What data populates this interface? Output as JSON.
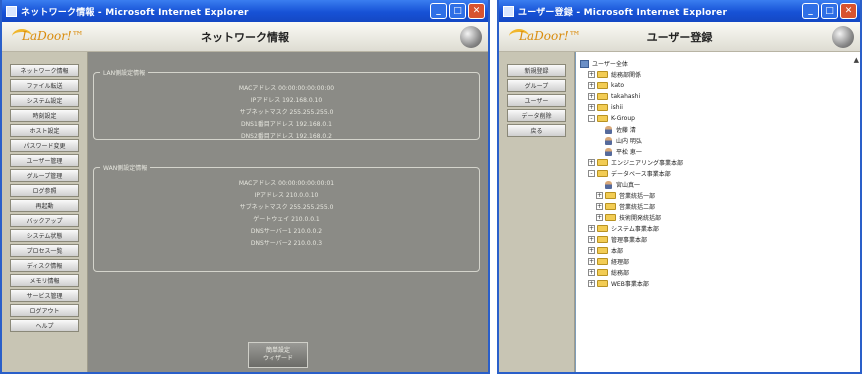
{
  "window1": {
    "title": "ネットワーク情報 - Microsoft Internet Explorer",
    "logo": "LaDoor!™",
    "app_title": "ネットワーク情報",
    "sidebar": [
      "ネットワーク情報",
      "ファイル転送",
      "システム設定",
      "時刻設定",
      "ホスト設定",
      "パスワード変更",
      "ユーザー管理",
      "グループ管理",
      "ログ参照",
      "再起動",
      "バックアップ",
      "システム状態",
      "プロセス一覧",
      "ディスク情報",
      "メモリ情報",
      "サービス管理",
      "ログアウト",
      "ヘルプ"
    ],
    "group1": {
      "legend": "LAN側設定情報",
      "rows": [
        "MACアドレス 00:00:00:00:00:00",
        "IPアドレス 192.168.0.10",
        "サブネットマスク 255.255.255.0",
        "DNS1番目アドレス 192.168.0.1",
        "DNS2番目アドレス 192.168.0.2"
      ]
    },
    "group2": {
      "legend": "WAN側設定情報",
      "rows": [
        "MACアドレス 00:00:00:00:00:01",
        "IPアドレス 210.0.0.10",
        "サブネットマスク 255.255.255.0",
        "ゲートウェイ 210.0.0.1",
        "DNSサーバー1 210.0.0.2",
        "DNSサーバー2 210.0.0.3"
      ]
    },
    "setup_button": [
      "簡単設定",
      "ウィザード"
    ]
  },
  "window2": {
    "title": "ユーザー登録 - Microsoft Internet Explorer",
    "logo": "LaDoor!™",
    "app_title": "ユーザー登録",
    "sidebar": [
      "新規登録",
      "グループ",
      "ユーザー",
      "データ削除",
      "戻る"
    ],
    "tree": [
      {
        "depth": 0,
        "type": "root",
        "exp": "",
        "label": "ユーザー全体"
      },
      {
        "depth": 1,
        "type": "folder",
        "exp": "+",
        "label": "総務部関係"
      },
      {
        "depth": 1,
        "type": "folder",
        "exp": "+",
        "label": "kato"
      },
      {
        "depth": 1,
        "type": "folder",
        "exp": "+",
        "label": "takahashi"
      },
      {
        "depth": 1,
        "type": "folder",
        "exp": "+",
        "label": "ishii"
      },
      {
        "depth": 1,
        "type": "folder",
        "exp": "-",
        "label": "K-Group"
      },
      {
        "depth": 2,
        "type": "user",
        "exp": "",
        "label": "佐藤 清"
      },
      {
        "depth": 2,
        "type": "user",
        "exp": "",
        "label": "山内 明弘"
      },
      {
        "depth": 2,
        "type": "user",
        "exp": "",
        "label": "平松 恵一"
      },
      {
        "depth": 1,
        "type": "folder",
        "exp": "+",
        "label": "エンジニアリング事業本部"
      },
      {
        "depth": 1,
        "type": "folder",
        "exp": "-",
        "label": "データベース事業本部"
      },
      {
        "depth": 2,
        "type": "user",
        "exp": "",
        "label": "宮山真一"
      },
      {
        "depth": 2,
        "type": "folder",
        "exp": "+",
        "label": "営業統括一部"
      },
      {
        "depth": 2,
        "type": "folder",
        "exp": "+",
        "label": "営業統括二部"
      },
      {
        "depth": 2,
        "type": "folder",
        "exp": "+",
        "label": "技術開発統括部"
      },
      {
        "depth": 1,
        "type": "folder",
        "exp": "+",
        "label": "システム事業本部"
      },
      {
        "depth": 1,
        "type": "folder",
        "exp": "+",
        "label": "管理事業本部"
      },
      {
        "depth": 1,
        "type": "folder",
        "exp": "+",
        "label": "本部"
      },
      {
        "depth": 1,
        "type": "folder",
        "exp": "+",
        "label": "経理部"
      },
      {
        "depth": 1,
        "type": "folder",
        "exp": "+",
        "label": "総務部"
      },
      {
        "depth": 1,
        "type": "folder",
        "exp": "+",
        "label": "WEB事業本部"
      }
    ]
  }
}
